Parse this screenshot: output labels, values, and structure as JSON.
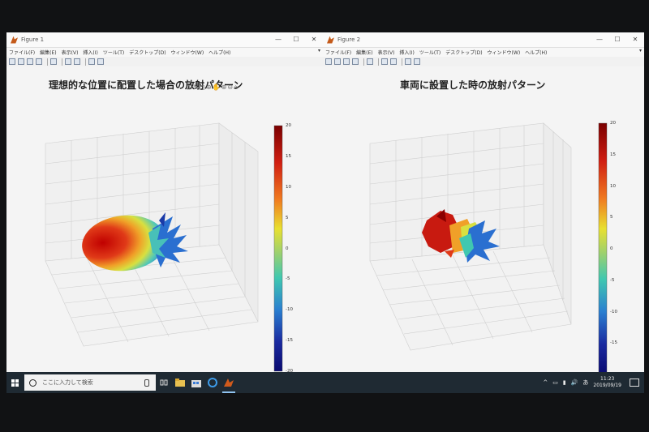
{
  "window1": {
    "title": "Figure 1",
    "controls": [
      "—",
      "☐",
      "✕"
    ],
    "menu": [
      "ファイル(F)",
      "編集(E)",
      "表示(V)",
      "挿入(I)",
      "ツール(T)",
      "デスクトップ(D)",
      "ウィンドウ(W)",
      "ヘルプ(H)"
    ],
    "plot_title": "理想的な位置に配置した場合の放射パターン",
    "axes_toolbar": "⊡✎▢⊕✋⊕⊖⌂"
  },
  "window2": {
    "title": "Figure 2",
    "controls": [
      "—",
      "☐",
      "✕"
    ],
    "menu": [
      "ファイル(F)",
      "編集(E)",
      "表示(V)",
      "挿入(I)",
      "ツール(T)",
      "デスクトップ(D)",
      "ウィンドウ(W)",
      "ヘルプ(H)"
    ],
    "plot_title": "車両に設置した時の放射パターン"
  },
  "colorbar": {
    "ticks": [
      "20",
      "15",
      "10",
      "5",
      "0",
      "-5",
      "-10",
      "-15",
      "-20"
    ],
    "colors": [
      "#7a0000",
      "#d01e12",
      "#f0a020",
      "#e8e030",
      "#9ad070",
      "#40c8b0",
      "#2a7fd0",
      "#1a2aa0",
      "#0a0a70"
    ]
  },
  "taskbar": {
    "search_placeholder": "ここに入力して検索",
    "icons": [
      "windows-icon",
      "task-view-icon",
      "file-explorer-icon",
      "store-icon",
      "edge-icon",
      "matlab-icon"
    ],
    "tray": [
      "^",
      "▭",
      "▮",
      "🔊",
      "あ"
    ],
    "time": "11:23",
    "date": "2019/09/19"
  }
}
